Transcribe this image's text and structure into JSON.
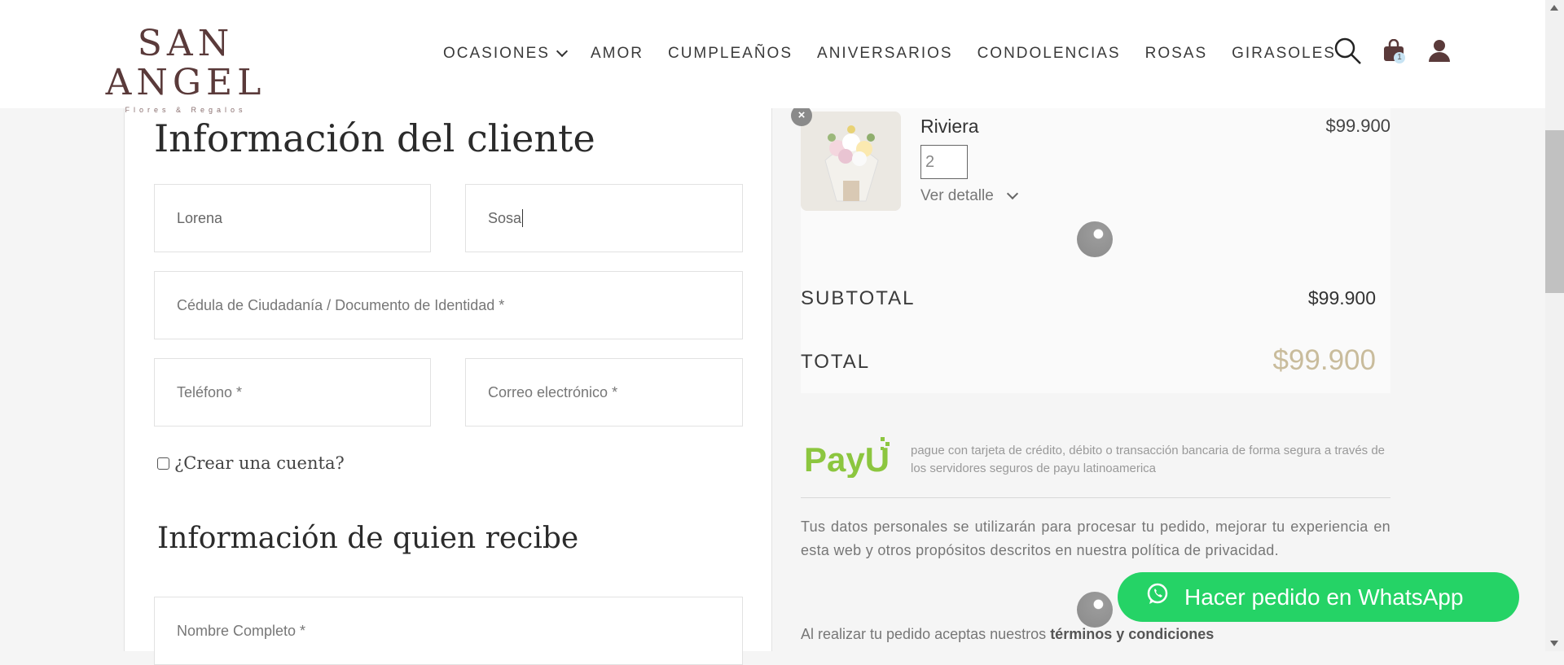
{
  "header": {
    "logo_main": "SAN ANGEL",
    "logo_sub": "Flores & Regalos",
    "nav": [
      {
        "label": "OCASIONES"
      },
      {
        "label": "AMOR"
      },
      {
        "label": "CUMPLEAÑOS"
      },
      {
        "label": "ANIVERSARIOS"
      },
      {
        "label": "CONDOLENCIAS"
      },
      {
        "label": "ROSAS"
      },
      {
        "label": "GIRASOLES"
      }
    ],
    "cart_count": "1"
  },
  "customer": {
    "title": "Información del cliente",
    "first_name": "Lorena",
    "last_name": "Sosa",
    "id_placeholder": "Cédula de Ciudadanía / Documento de Identidad *",
    "phone_placeholder": "Teléfono *",
    "email_placeholder": "Correo electrónico *",
    "create_account": "¿Crear una cuenta?"
  },
  "recipient": {
    "title": "Información de quien recibe",
    "name_placeholder": "Nombre Completo *"
  },
  "cart": {
    "remove": "×",
    "product_name": "Riviera",
    "product_price": "$99.900",
    "quantity": "2",
    "details_label": "Ver detalle",
    "subtotal_label": "SUBTOTAL",
    "subtotal_value": "$99.900",
    "total_label": "TOTAL",
    "total_value": "$99.900"
  },
  "payment": {
    "brand": "PayU",
    "description": "pague con tarjeta de crédito, débito o transacción bancaria de forma segura a través de los servidores seguros de payu latinoamerica"
  },
  "privacy_text": "Tus datos personales se utilizarán para procesar tu pedido, mejorar tu experiencia en esta web y otros propósitos descritos en nuestra política de privacidad.",
  "terms": {
    "prefix": "Al realizar tu pedido aceptas nuestros ",
    "link": "términos y condiciones"
  },
  "whatsapp_button": "Hacer pedido en WhatsApp",
  "colors": {
    "brand": "#5a3a3a",
    "whatsapp": "#25d366",
    "total": "#c9bc9c",
    "payu_green": "#8cc63f"
  }
}
